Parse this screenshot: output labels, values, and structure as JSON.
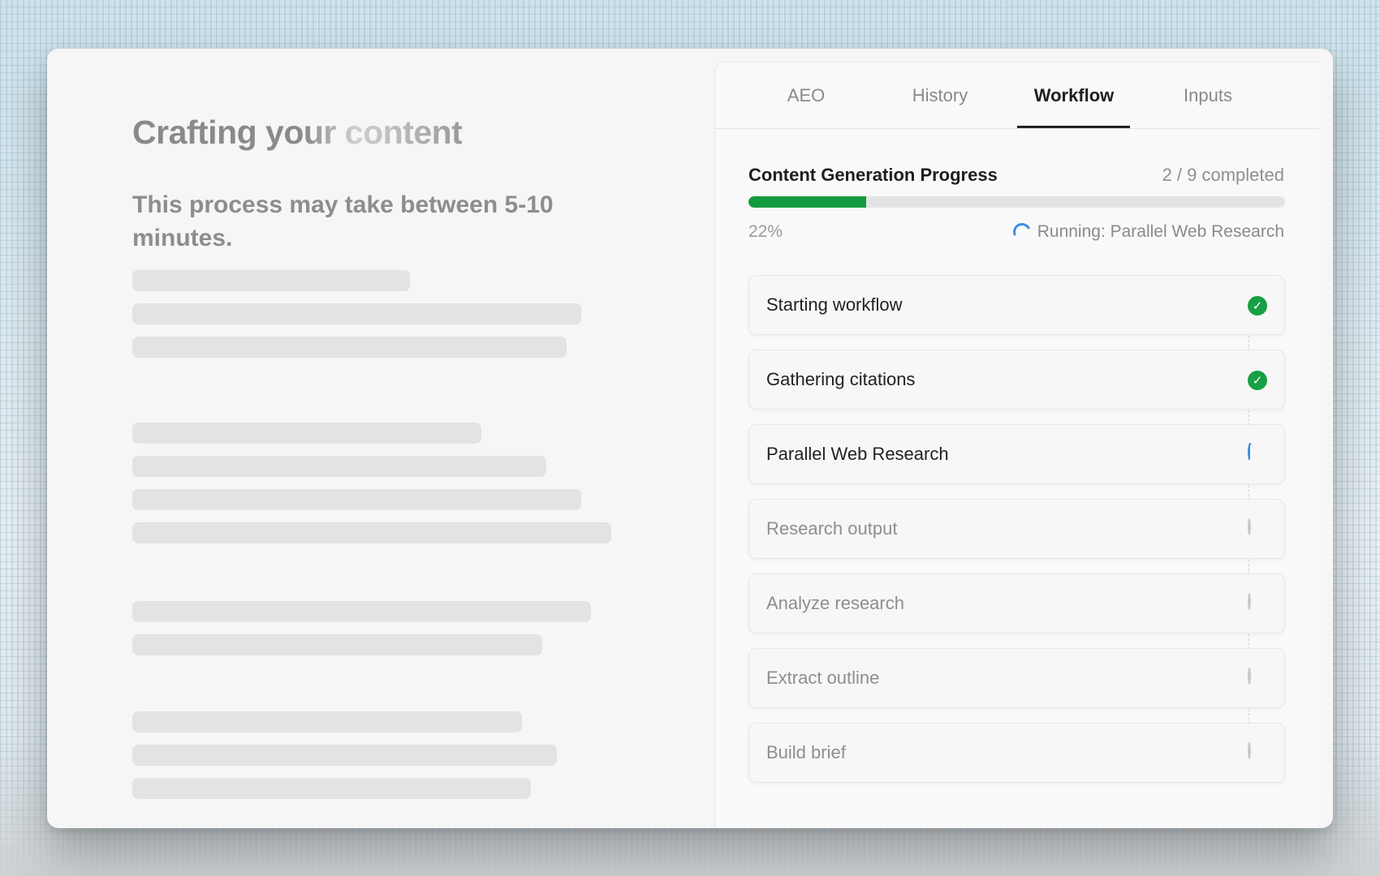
{
  "left": {
    "title": "Crafting your content",
    "subtitle": "This process may take between 5-10 minutes."
  },
  "tabs": [
    {
      "label": "AEO"
    },
    {
      "label": "History"
    },
    {
      "label": "Workflow"
    },
    {
      "label": "Inputs"
    }
  ],
  "active_tab": "Workflow",
  "progress": {
    "title": "Content Generation Progress",
    "count": "2 / 9 completed",
    "percent_label": "22%",
    "fraction": 0.22,
    "running_label": "Running: Parallel Web Research"
  },
  "steps": [
    {
      "label": "Starting workflow",
      "status": "complete"
    },
    {
      "label": "Gathering citations",
      "status": "complete"
    },
    {
      "label": "Parallel Web Research",
      "status": "running"
    },
    {
      "label": "Research output",
      "status": "pending"
    },
    {
      "label": "Analyze research",
      "status": "pending"
    },
    {
      "label": "Extract outline",
      "status": "pending"
    },
    {
      "label": "Build brief",
      "status": "pending"
    }
  ],
  "colors": {
    "accent_green": "#149a3e",
    "spinner_blue": "#3b8be6"
  }
}
